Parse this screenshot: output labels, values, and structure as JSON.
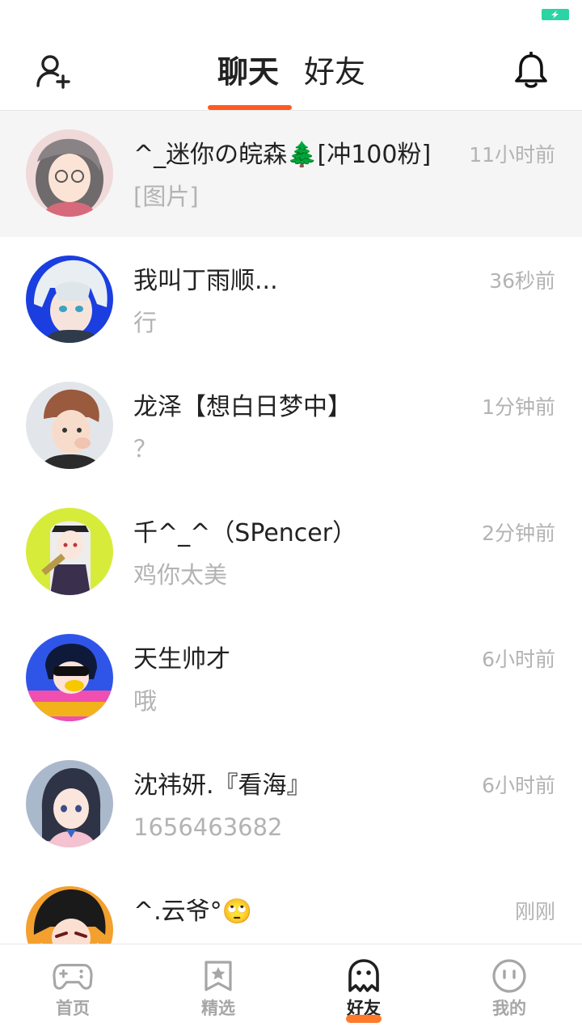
{
  "header": {
    "tabs": [
      {
        "label": "聊天",
        "active": true
      },
      {
        "label": "好友",
        "active": false
      }
    ],
    "add_friend_icon": "add-user-icon",
    "notification_icon": "bell-icon"
  },
  "colors": {
    "accent": "#ff5a1f",
    "battery": "#2bd4a4",
    "muted_text": "#b3b3b3",
    "pinned_background": "#f5f5f5"
  },
  "chats": [
    {
      "name": "^_迷你の皖森🌲[冲100粉]",
      "time": "11小时前",
      "preview": "[图片]",
      "pinned": true
    },
    {
      "name": "我叫丁雨顺...",
      "time": "36秒前",
      "preview": "行",
      "pinned": false
    },
    {
      "name": "龙泽【想白日梦中】",
      "time": "1分钟前",
      "preview": "？",
      "pinned": false
    },
    {
      "name": "千^_^（SPencer）",
      "time": "2分钟前",
      "preview": "鸡你太美",
      "pinned": false
    },
    {
      "name": "天生帅才",
      "time": "6小时前",
      "preview": "哦",
      "pinned": false
    },
    {
      "name": "沈祎妍.『看海』",
      "time": "6小时前",
      "preview": "1656463682",
      "pinned": false
    },
    {
      "name": "^.云爷°🙄",
      "time": "刚刚",
      "preview": "",
      "pinned": false
    }
  ],
  "bottom_nav": [
    {
      "label": "首页",
      "icon": "gamepad-icon",
      "active": false
    },
    {
      "label": "精选",
      "icon": "star-badge-icon",
      "active": false
    },
    {
      "label": "好友",
      "icon": "ghost-icon",
      "active": true
    },
    {
      "label": "我的",
      "icon": "face-icon",
      "active": false
    }
  ]
}
